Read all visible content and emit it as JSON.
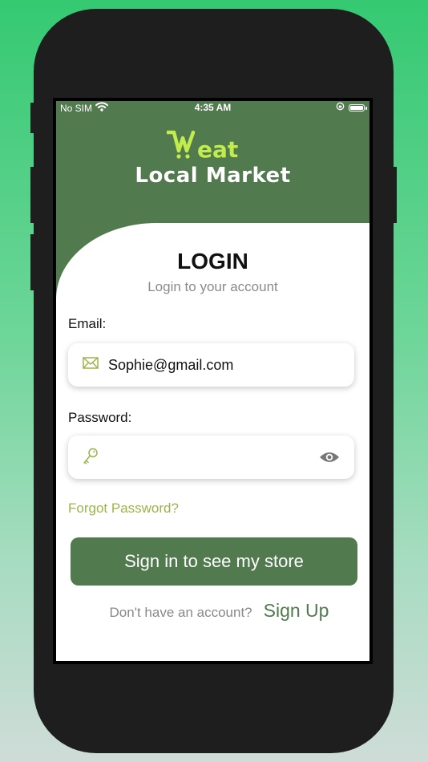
{
  "status_bar": {
    "carrier": "No SIM",
    "time": "4:35 AM"
  },
  "brand": {
    "logo_word": "eat",
    "app_name": "Local Market",
    "logo_color": "#c2ec4c",
    "primary_color": "#527a4f"
  },
  "login": {
    "title": "LOGIN",
    "subtitle": "Login to your account",
    "email_label": "Email:",
    "email_value": "Sophie@gmail.com",
    "email_icon": "envelope-icon",
    "password_label": "Password:",
    "password_value": "",
    "password_icon": "key-icon",
    "visibility_icon": "eye-icon",
    "forgot_password": "Forgot Password?",
    "sign_in_button": "Sign in to see my store",
    "signup_prompt": "Don't have an account?",
    "signup_link": "Sign Up"
  }
}
